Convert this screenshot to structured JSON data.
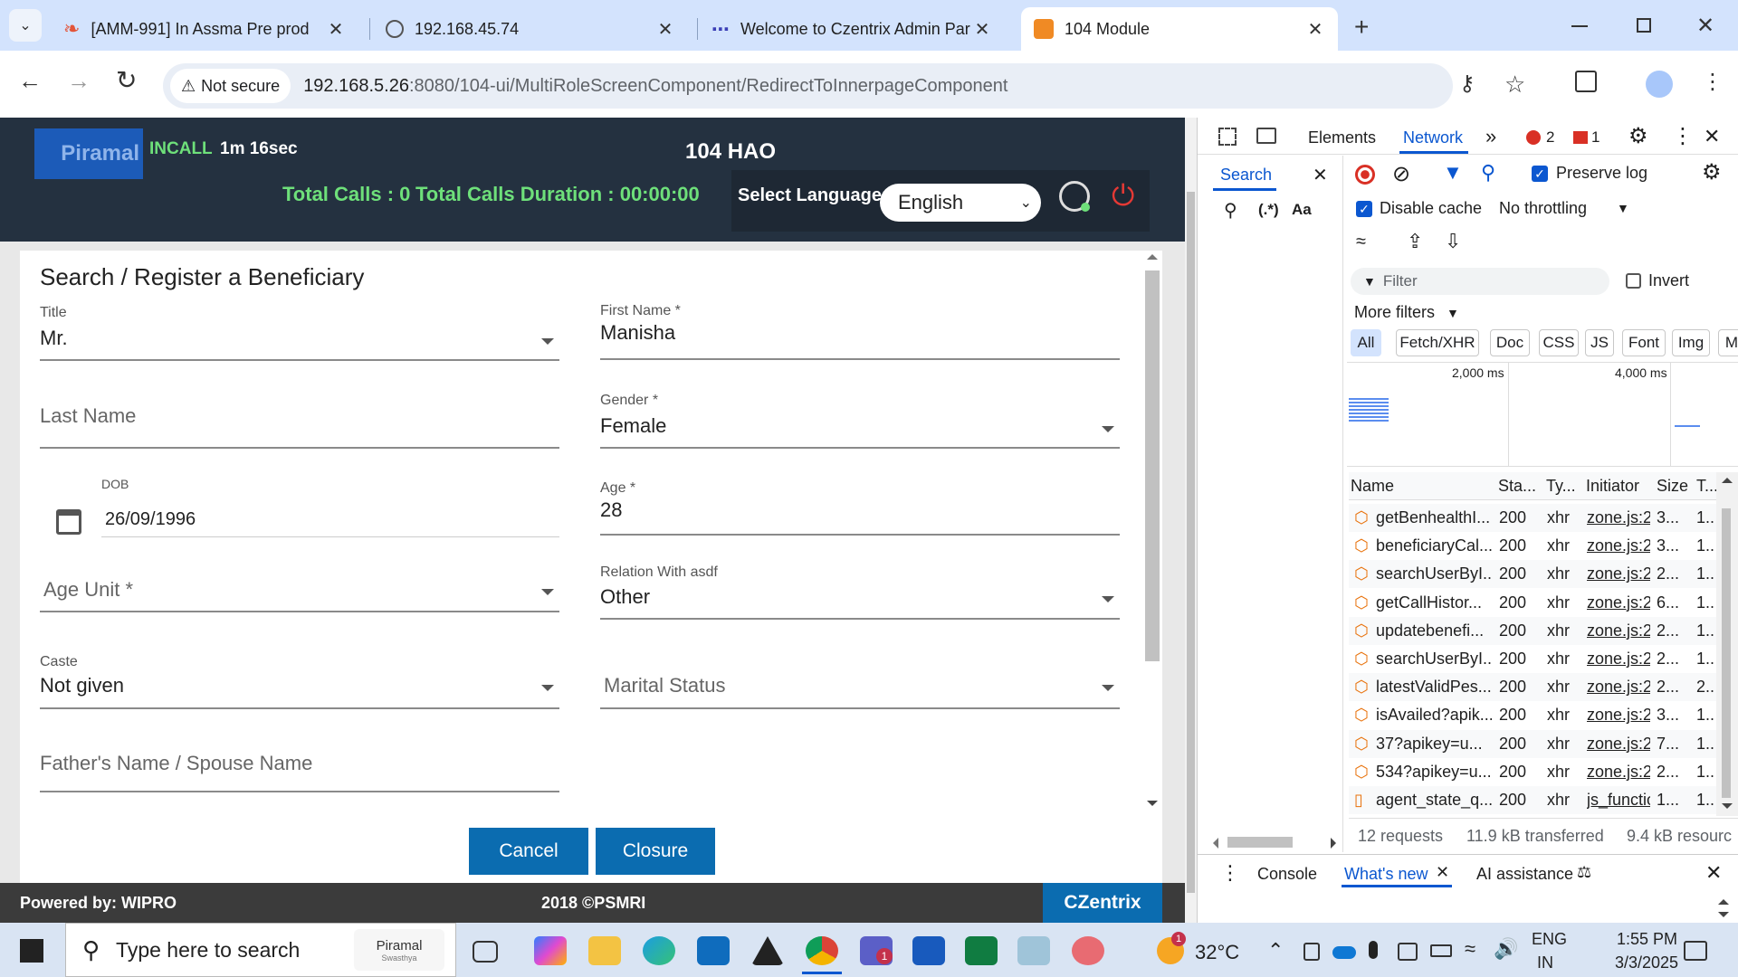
{
  "browser": {
    "tabs": [
      {
        "title": "[AMM-991] In Assma Pre prod",
        "icon": "piramal-icon"
      },
      {
        "title": "192.168.45.74",
        "icon": "globe-icon"
      },
      {
        "title": "Welcome to Czentrix Admin Par",
        "icon": "grid-icon"
      },
      {
        "title": "104 Module",
        "icon": "piramal-icon"
      }
    ],
    "security_label": "Not secure",
    "url_host": "192.168.5.26",
    "url_path": ":8080/104-ui/MultiRoleScreenComponent/RedirectToInnerpageComponent"
  },
  "app": {
    "logo_text": "Piramal",
    "call_status": "INCALL",
    "call_timer": "1m 16sec",
    "module_title": "104 HAO",
    "total_calls": "Total Calls : 0",
    "total_duration": "Total Calls Duration : 00:00:00",
    "language_label": "Select Language:",
    "language_value": "English",
    "form_title": "Search / Register a Beneficiary",
    "title_label": "Title",
    "title_value": "Mr.",
    "first_name_label": "First Name *",
    "first_name_value": "Manisha",
    "last_name_placeholder": "Last Name",
    "gender_label": "Gender *",
    "gender_value": "Female",
    "dob_label": "DOB",
    "dob_value": "26/09/1996",
    "age_label": "Age *",
    "age_value": "28",
    "age_unit_placeholder": "Age Unit *",
    "relation_label": "Relation With asdf",
    "relation_value": "Other",
    "caste_label": "Caste",
    "caste_value": "Not given",
    "marital_placeholder": "Marital Status",
    "father_placeholder": "Father's Name / Spouse Name",
    "cancel_label": "Cancel",
    "closure_label": "Closure",
    "footer_left": "Powered by: WIPRO",
    "footer_center": "2018 ©PSMRI",
    "footer_right": "CZentrix"
  },
  "devtools": {
    "tabs": [
      "Elements",
      "Network"
    ],
    "error_count": "2",
    "issue_count": "1",
    "search_tab": "Search",
    "regex_label": "(.*)",
    "case_label": "Aa",
    "preserve_log": "Preserve log",
    "disable_cache": "Disable cache",
    "throttling": "No throttling",
    "filter_placeholder": "Filter",
    "invert": "Invert",
    "more_filters": "More filters",
    "type_filters": [
      "All",
      "Fetch/XHR",
      "Doc",
      "CSS",
      "JS",
      "Font",
      "Img",
      "M"
    ],
    "timeline_ticks": [
      "2,000 ms",
      "4,000 ms"
    ],
    "columns": [
      "Name",
      "Sta...",
      "Ty...",
      "Initiator",
      "Size",
      "T..."
    ],
    "requests": [
      {
        "name": "getBenhealthI...",
        "status": "200",
        "type": "xhr",
        "initiator": "zone.js:2",
        "size": "3...",
        "time": "1..."
      },
      {
        "name": "beneficiaryCal...",
        "status": "200",
        "type": "xhr",
        "initiator": "zone.js:2",
        "size": "3...",
        "time": "1..."
      },
      {
        "name": "searchUserByI...",
        "status": "200",
        "type": "xhr",
        "initiator": "zone.js:2",
        "size": "2...",
        "time": "1..."
      },
      {
        "name": "getCallHistor...",
        "status": "200",
        "type": "xhr",
        "initiator": "zone.js:2",
        "size": "6...",
        "time": "1..."
      },
      {
        "name": "updatebenefi...",
        "status": "200",
        "type": "xhr",
        "initiator": "zone.js:2",
        "size": "2...",
        "time": "1..."
      },
      {
        "name": "searchUserByI...",
        "status": "200",
        "type": "xhr",
        "initiator": "zone.js:2",
        "size": "2...",
        "time": "1..."
      },
      {
        "name": "latestValidPes...",
        "status": "200",
        "type": "xhr",
        "initiator": "zone.js:2",
        "size": "2...",
        "time": "2..."
      },
      {
        "name": "isAvailed?apik...",
        "status": "200",
        "type": "xhr",
        "initiator": "zone.js:2",
        "size": "3...",
        "time": "1..."
      },
      {
        "name": "37?apikey=u...",
        "status": "200",
        "type": "xhr",
        "initiator": "zone.js:2",
        "size": "7...",
        "time": "1..."
      },
      {
        "name": "534?apikey=u...",
        "status": "200",
        "type": "xhr",
        "initiator": "zone.js:2",
        "size": "2...",
        "time": "1..."
      },
      {
        "name": "agent_state_q...",
        "status": "200",
        "type": "xhr",
        "initiator": "js_functio",
        "size": "1...",
        "time": "1..."
      }
    ],
    "summary_requests": "12 requests",
    "summary_transferred": "11.9 kB transferred",
    "summary_resources": "9.4 kB resourc",
    "drawer_tabs": [
      "Console",
      "What's new",
      "AI assistance"
    ]
  },
  "taskbar": {
    "search_placeholder": "Type here to search",
    "search_brand": "Piramal",
    "search_brand_sub": "Swasthya",
    "teams_badge": "1",
    "weather_badge": "1",
    "temperature": "32°C",
    "lang_1": "ENG",
    "lang_2": "IN",
    "time": "1:55 PM",
    "date": "3/3/2025"
  },
  "colors": {
    "app_header": "#243140",
    "accent_green": "#6ee07a",
    "button_blue": "#0b6cb0",
    "devtools_blue": "#0b57d0",
    "error_red": "#d93025"
  }
}
